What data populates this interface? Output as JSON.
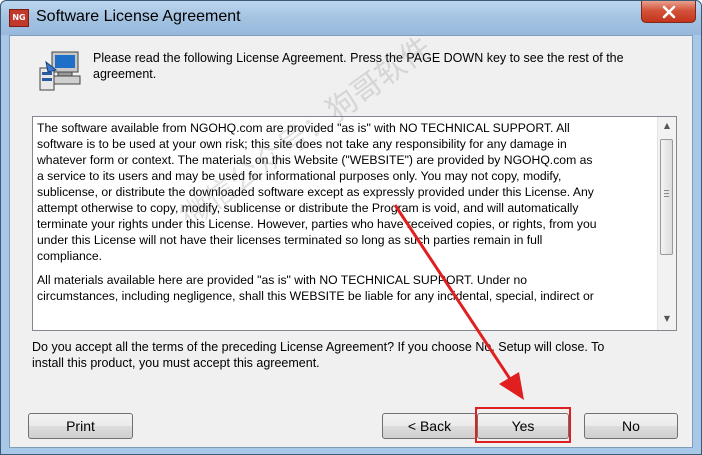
{
  "window": {
    "title": "Software License Agreement",
    "app_icon_text": "NG",
    "close_icon": "close-icon"
  },
  "header": {
    "icon": "setup-computer-icon",
    "instruction_lines": [
      "Please read the following License Agreement. Press the PAGE DOWN key to see the rest of the",
      "agreement."
    ]
  },
  "license": {
    "paragraph1": [
      "The software available from NGOHQ.com are provided \"as is\" with NO TECHNICAL SUPPORT. All",
      "software is to be used at your own risk; this site does not take any responsibility for any damage in",
      "whatever form or context. The materials on this Website (\"WEBSITE\") are provided by NGOHQ.com as",
      "a service to its users and may be used for informational purposes only. You may not copy, modify,",
      "sublicense, or distribute the downloaded software except as expressly provided under this License. Any",
      "attempt otherwise to copy, modify, sublicense or distribute the Program is void, and will automatically",
      "terminate your rights under this License. However, parties who have received copies, or rights, from you",
      "under this License will not have their licenses terminated so long as such parties remain in full",
      "compliance."
    ],
    "paragraph2": [
      "All materials available here are provided \"as is\" with NO TECHNICAL SUPPORT. Under no",
      "circumstances, including negligence, shall this WEBSITE be liable for any incidental, special, indirect or"
    ]
  },
  "question": {
    "lines": [
      "Do you accept all the terms of the preceding License Agreement? If you choose No, Setup will close. To",
      "install this product, you must accept this agreement."
    ]
  },
  "buttons": {
    "print": "Print",
    "back": "< Back",
    "yes": "Yes",
    "no": "No"
  },
  "overlay": {
    "watermark": "微信公众号：狗哥软件"
  },
  "colors": {
    "highlight": "#e02020",
    "title_bar": "#a9c7e6",
    "close_button": "#c3331b"
  }
}
